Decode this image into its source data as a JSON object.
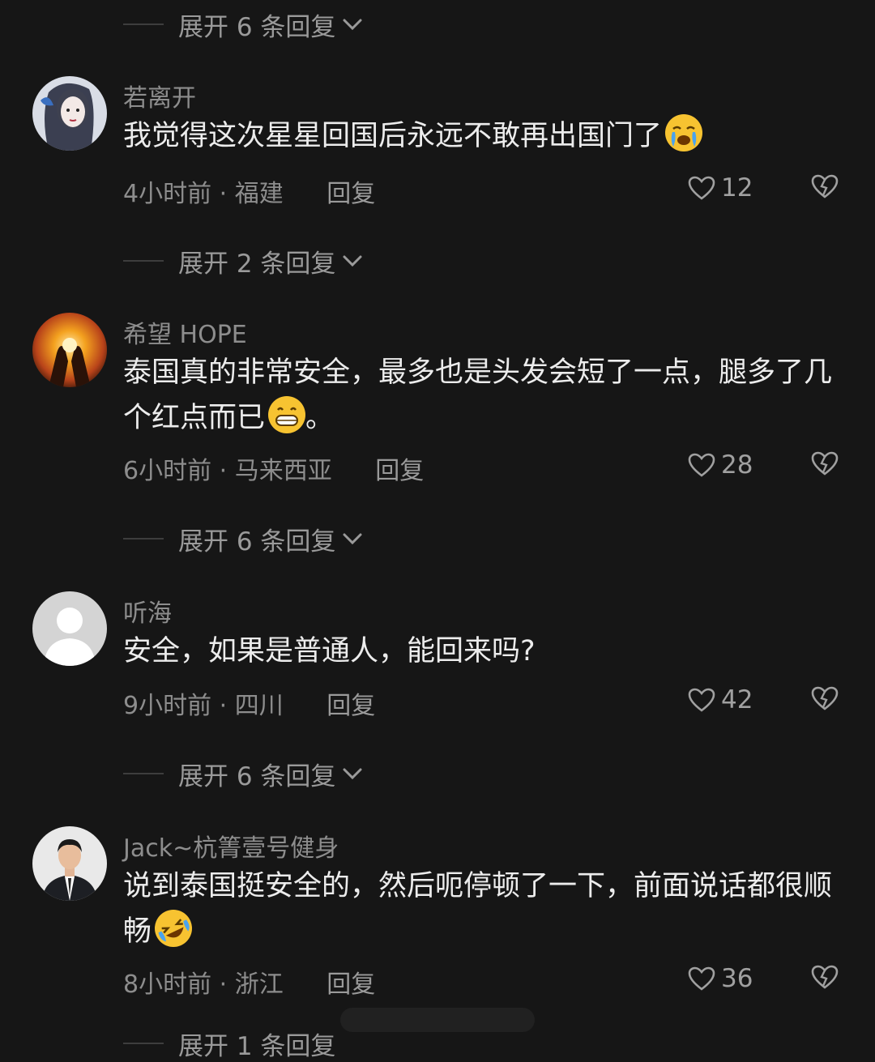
{
  "expand_labels": {
    "top": "展开 6 条回复",
    "after_1": "展开 2 条回复",
    "after_2": "展开 6 条回复",
    "after_3": "展开 6 条回复",
    "bottom": "展开 1 条回复"
  },
  "comments": [
    {
      "username": "若离开",
      "text": "我觉得这次星星回国后永远不敢再出国门了",
      "emoji": "crying-face",
      "time": "4小时前",
      "location": "福建",
      "reply_label": "回复",
      "likes": "12"
    },
    {
      "username": "希望 HOPE",
      "text": "泰国真的非常安全，最多也是头发会短了一点，腿多了几个红点而已",
      "emoji": "grinning-face",
      "text_suffix": "。",
      "time": "6小时前",
      "location": "马来西亚",
      "reply_label": "回复",
      "likes": "28"
    },
    {
      "username": "听海",
      "text": "安全，如果是普通人，能回来吗?",
      "time": "9小时前",
      "location": "四川",
      "reply_label": "回复",
      "likes": "42"
    },
    {
      "username": "Jack~杭箐壹号健身",
      "text": "说到泰国挺安全的，然后呃停顿了一下，前面说话都很顺畅",
      "emoji": "rolling-laughing-face",
      "time": "8小时前",
      "location": "浙江",
      "reply_label": "回复",
      "likes": "36"
    }
  ],
  "colors": {
    "background": "#161616",
    "text": "#ececec",
    "muted": "#8d8d8d",
    "emoji": "#f7c331"
  }
}
